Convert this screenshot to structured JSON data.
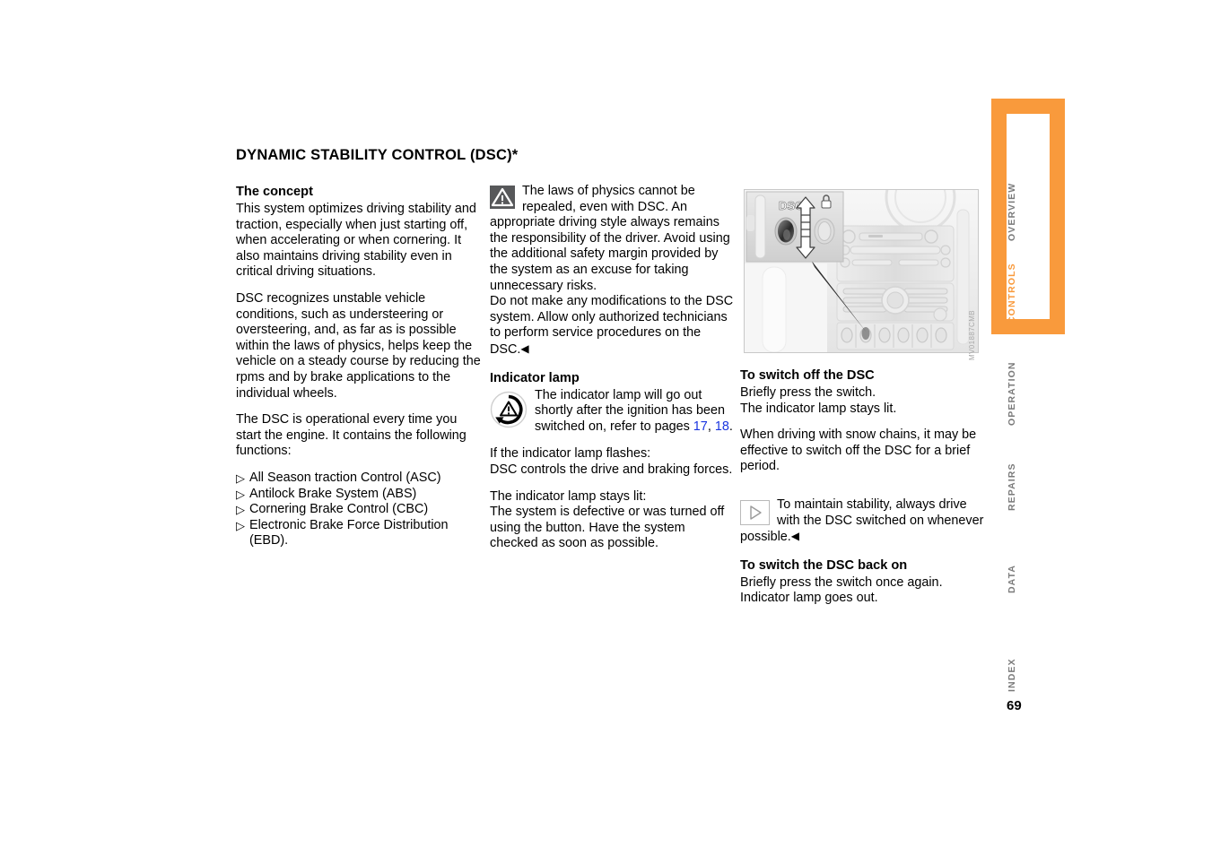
{
  "document": {
    "title": "DYNAMIC STABILITY CONTROL (DSC)*",
    "page_number": "69",
    "figure_code": "MV01887CMB"
  },
  "column_1": {
    "heading": "The concept",
    "paragraph_1": "This system optimizes driving stability and traction, especially when just starting off, when accelerating or when cornering. It also maintains driving stability even in critical driving situations.",
    "paragraph_2": "DSC recognizes unstable vehicle conditions, such as understeering or oversteering, and, as far as is possible within the laws of physics, helps keep the vehicle on a steady course by reducing the rpms and by brake applications to the individual wheels.",
    "paragraph_3": "The DSC is operational every time you start the engine. It contains the following functions:",
    "bullet_marker": "▷",
    "functions": [
      "All Season traction Control (ASC)",
      "Antilock Brake System (ABS)",
      "Cornering Brake Control (CBC)",
      "Electronic Brake Force Distribution (EBD)."
    ]
  },
  "column_2": {
    "warning_text": "The laws of physics cannot be repealed, even with DSC. An appropriate driving style always remains the responsibility of the driver. Avoid using the additional safety margin provided by the system as an excuse for taking unnecessary risks.",
    "warning_text_2": "Do not make any modifications to the DSC system. Allow only authorized technicians to perform service procedures on the DSC.",
    "end_marker": "◀",
    "heading": "Indicator lamp",
    "lamp_text_before": "The indicator lamp will go out shortly after the ignition has been switched on, refer to pages ",
    "lamp_link_1": "17",
    "lamp_link_sep": ", ",
    "lamp_link_2": "18",
    "lamp_text_after": ".",
    "flash_label": "If the indicator lamp flashes:",
    "flash_text": "DSC controls the drive and braking forces.",
    "lit_label": "The indicator lamp stays lit:",
    "lit_text": "The system is defective or was turned off using the button. Have the system checked as soon as possible."
  },
  "column_3": {
    "heading_off": "To switch off the DSC",
    "off_line_1": "Briefly press the switch.",
    "off_line_2": "The indicator lamp stays lit.",
    "off_paragraph": "When driving with snow chains, it may be effective to switch off the DSC for a brief period.",
    "note_text": "To maintain stability, always drive with the DSC switched on whenever possible.",
    "note_end_marker": "◀",
    "heading_on": "To switch the DSC back on",
    "on_line_1": "Briefly press the switch once again.",
    "on_line_2": "Indicator lamp goes out."
  },
  "figure": {
    "inset_label": "DSC",
    "alt": "Center console with DSC switch, magnified inset showing switch and double arrow"
  },
  "side_tabs": {
    "items": [
      {
        "label": "OVERVIEW",
        "active": false
      },
      {
        "label": "CONTROLS",
        "active": true
      },
      {
        "label": "OPERATION",
        "active": false
      },
      {
        "label": "REPAIRS",
        "active": false
      },
      {
        "label": "DATA",
        "active": false
      },
      {
        "label": "INDEX",
        "active": false
      }
    ]
  },
  "colors": {
    "accent_orange": "#f99a3c",
    "link_blue": "#1a35e0",
    "tab_inactive_gray": "#7a7a7a",
    "warning_icon_bg": "#57585a"
  }
}
